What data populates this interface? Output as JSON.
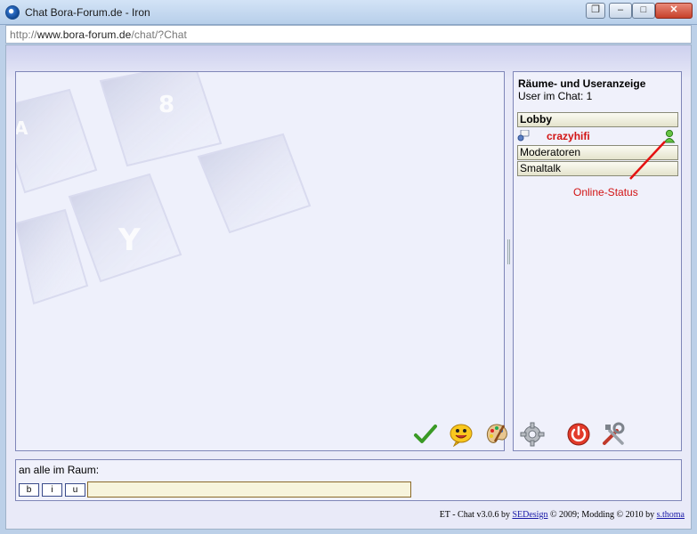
{
  "window": {
    "title": "Chat Bora-Forum.de - Iron",
    "controls": {
      "minimize": "–",
      "maximize": "□",
      "close": "✕"
    }
  },
  "address": {
    "scheme": "http://",
    "host": "www.bora-forum.de",
    "path": "/chat/?Chat"
  },
  "users_panel": {
    "heading": "Räume- und Useranzeige",
    "user_count_label": "User im Chat: 1",
    "rooms": [
      {
        "label": "Lobby"
      },
      {
        "label": "Moderatoren"
      },
      {
        "label": "Smaltalk"
      }
    ],
    "users": [
      {
        "name": "crazyhifi",
        "status": "online"
      }
    ]
  },
  "annotation": {
    "label": "Online-Status"
  },
  "input": {
    "recipient_label": "an alle im Raum:",
    "format_buttons": {
      "bold": "b",
      "italic": "i",
      "underline": "u"
    },
    "message_value": "",
    "tools": [
      {
        "name": "send",
        "icon": "checkmark-icon"
      },
      {
        "name": "smileys",
        "icon": "smiley-icon"
      },
      {
        "name": "colors",
        "icon": "palette-icon"
      },
      {
        "name": "settings",
        "icon": "gear-icon"
      },
      {
        "name": "logout",
        "icon": "power-icon"
      },
      {
        "name": "admin",
        "icon": "tools-icon"
      }
    ]
  },
  "footer": {
    "prefix": "ET - Chat v3.0.6 by ",
    "link1": "SEDesign",
    "middle": " © 2009; Modding © 2010 by ",
    "link2": "s.thoma"
  },
  "colors": {
    "user_name": "#d21414",
    "annotation": "#d21414",
    "panel_border": "#7f86b8"
  }
}
